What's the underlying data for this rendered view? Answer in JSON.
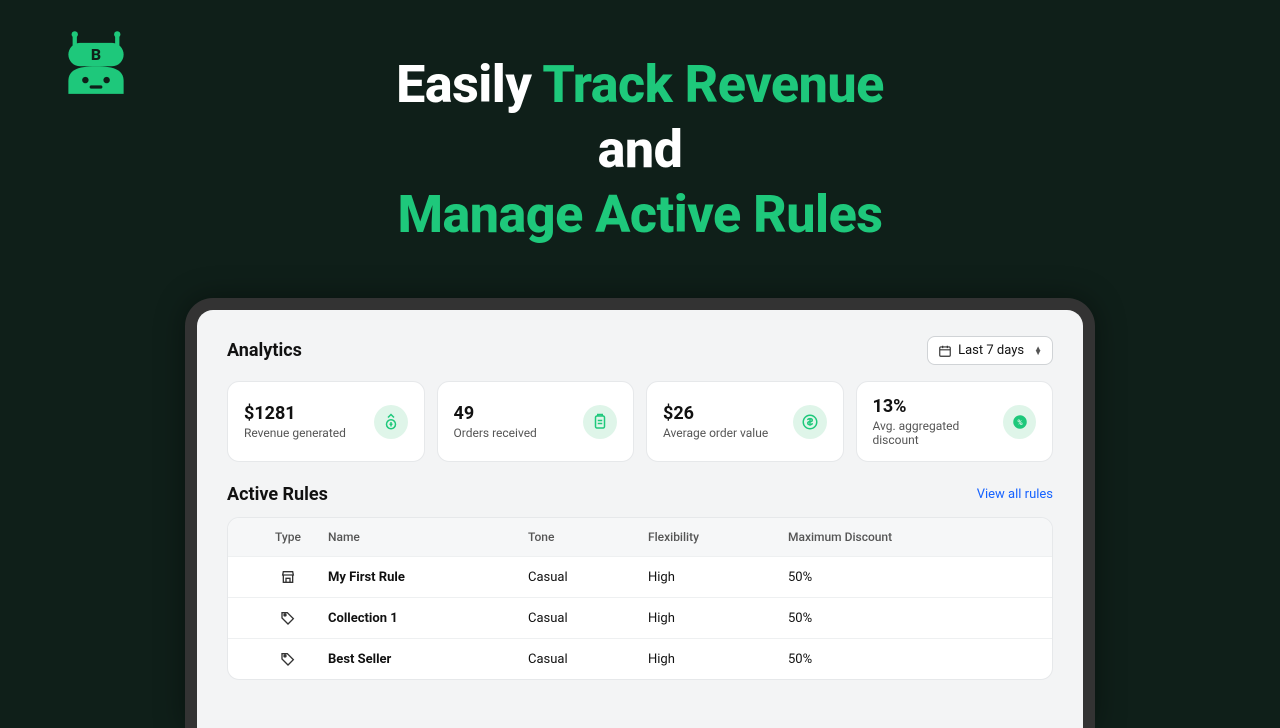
{
  "headline": {
    "line1_plain": "Easily ",
    "line1_accent": "Track Revenue",
    "line2_plain": "and",
    "line3_accent": "Manage Active Rules"
  },
  "analytics": {
    "title": "Analytics",
    "dateRange": "Last 7 days",
    "cards": [
      {
        "value": "$1281",
        "label": "Revenue generated"
      },
      {
        "value": "49",
        "label": "Orders received"
      },
      {
        "value": "$26",
        "label": "Average order value"
      },
      {
        "value": "13%",
        "label": "Avg. aggregated discount"
      }
    ]
  },
  "activeRules": {
    "title": "Active Rules",
    "viewAll": "View all rules",
    "columns": {
      "type": "Type",
      "name": "Name",
      "tone": "Tone",
      "flexibility": "Flexibility",
      "maxDiscount": "Maximum Discount"
    },
    "rows": [
      {
        "typeIcon": "store",
        "name": "My First Rule",
        "tone": "Casual",
        "flexibility": "High",
        "maxDiscount": "50%"
      },
      {
        "typeIcon": "tag",
        "name": "Collection 1",
        "tone": "Casual",
        "flexibility": "High",
        "maxDiscount": "50%"
      },
      {
        "typeIcon": "tag",
        "name": "Best Seller",
        "tone": "Casual",
        "flexibility": "High",
        "maxDiscount": "50%"
      }
    ]
  }
}
